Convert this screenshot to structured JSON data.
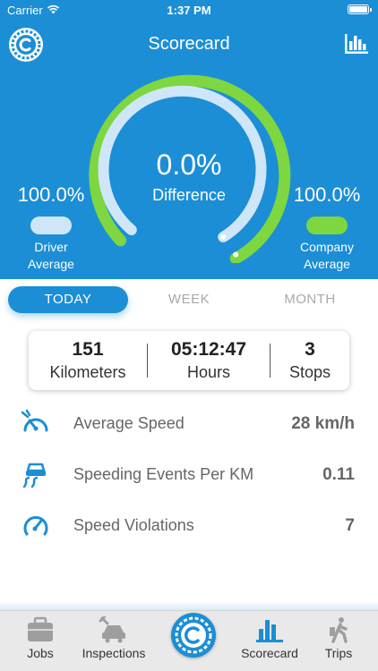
{
  "status_bar": {
    "carrier": "Carrier",
    "time": "1:37 PM"
  },
  "header": {
    "title": "Scorecard",
    "logo_icon": "compass-logo-icon",
    "chart_icon": "bar-chart-icon"
  },
  "gauge": {
    "difference_value": "0.0%",
    "difference_label": "Difference",
    "driver_arc_color": "#cfe6f8",
    "company_arc_color": "#7ed641"
  },
  "driver": {
    "percent": "100.0%",
    "label_line1": "Driver",
    "label_line2": "Average",
    "color": "#cfe6f8"
  },
  "company": {
    "percent": "100.0%",
    "label_line1": "Company",
    "label_line2": "Average",
    "color": "#7ed641"
  },
  "tabs": [
    {
      "label": "TODAY",
      "active": true
    },
    {
      "label": "WEEK",
      "active": false
    },
    {
      "label": "MONTH",
      "active": false
    }
  ],
  "stats": [
    {
      "value": "151",
      "label": "Kilometers"
    },
    {
      "value": "05:12:47",
      "label": "Hours"
    },
    {
      "value": "3",
      "label": "Stops"
    }
  ],
  "metrics": [
    {
      "icon": "speedometer-icon",
      "name": "Average Speed",
      "value": "28 km/h"
    },
    {
      "icon": "skidding-car-icon",
      "name": "Speeding Events Per KM",
      "value": "0.11"
    },
    {
      "icon": "gauge-icon",
      "name": "Speed Violations",
      "value": "7"
    }
  ],
  "nav": [
    {
      "icon": "briefcase-icon",
      "label": "Jobs"
    },
    {
      "icon": "wrench-car-icon",
      "label": "Inspections"
    },
    {
      "icon": "compass-logo-icon",
      "label": ""
    },
    {
      "icon": "bar-chart-icon",
      "label": "Scorecard"
    },
    {
      "icon": "walking-person-icon",
      "label": "Trips"
    }
  ],
  "colors": {
    "primary": "#1b8ed6",
    "accent_green": "#7ed641",
    "light_blue": "#cfe6f8"
  }
}
